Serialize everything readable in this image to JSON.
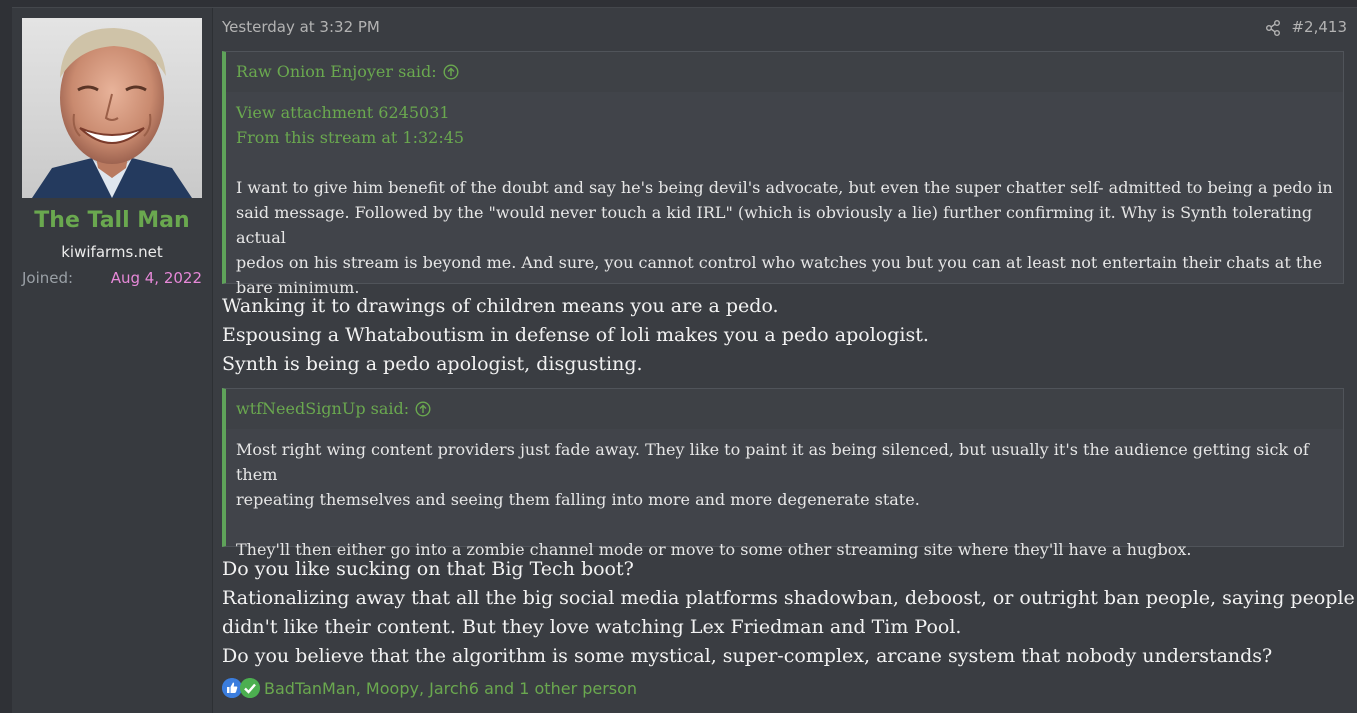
{
  "user": {
    "name": "The Tall Man",
    "site": "kiwifarms.net",
    "joined_label": "Joined:",
    "joined_date": "Aug 4, 2022"
  },
  "post": {
    "date": "Yesterday at 3:32 PM",
    "number": "#2,413",
    "quote1": {
      "author": "Raw Onion Enjoyer said:",
      "attachment": "View attachment 6245031",
      "stream_link": "From this stream at 1:32:45",
      "lines": [
        "I want to give him benefit of the doubt and say he's being devil's advocate, but even the super chatter self- admitted to being a pedo in",
        "said message. Followed by the \"would never touch a kid IRL\" (which is obviously a lie) further confirming it. Why is Synth tolerating actual",
        "pedos on his stream is beyond me. And sure, you cannot control who watches you but you can at least not entertain their chats at the",
        "bare minimum."
      ]
    },
    "reply1": [
      "Wanking it to drawings of children means you are a pedo.",
      "Espousing a Whataboutism in defense of loli makes you a pedo apologist.",
      "Synth is being a pedo apologist, disgusting."
    ],
    "quote2": {
      "author": "wtfNeedSignUp said:",
      "para1_lines": [
        "Most right wing content providers just fade away. They like to paint it as being silenced, but usually it's the audience getting sick of them",
        "repeating themselves and seeing them falling into more and more degenerate state."
      ],
      "para2": "They'll then either go into a zombie channel mode or move to some other streaming site where they'll have a hugbox."
    },
    "reply2": [
      "Do you like sucking on that Big Tech boot?",
      "Rationalizing away that all the big social media platforms shadowban, deboost, or outright ban people, saying people",
      "didn't like their content. But they love watching Lex Friedman and Tim Pool.",
      "Do you believe that the algorithm is some mystical, super-complex, arcane system that nobody understands?"
    ],
    "reactions": "BadTanMan, Moopy, Jarch6 and 1 other person"
  },
  "colors": {
    "accent_green": "#6aa84f",
    "joined_pink": "#e688d8",
    "background": "#2f3136"
  }
}
